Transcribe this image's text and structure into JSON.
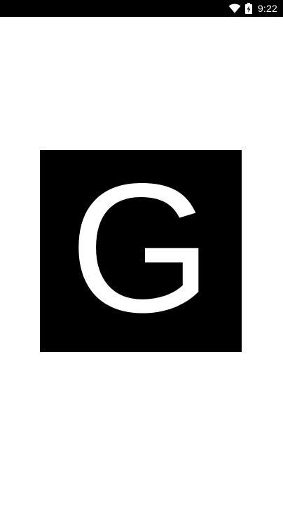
{
  "status_bar": {
    "time": "9:22",
    "icons": [
      "wifi-icon",
      "battery-charging-icon"
    ]
  },
  "splash": {
    "logo_letter": "G",
    "colors": {
      "background": "#ffffff",
      "logo_box": "#000000",
      "logo_letter": "#ffffff"
    }
  }
}
